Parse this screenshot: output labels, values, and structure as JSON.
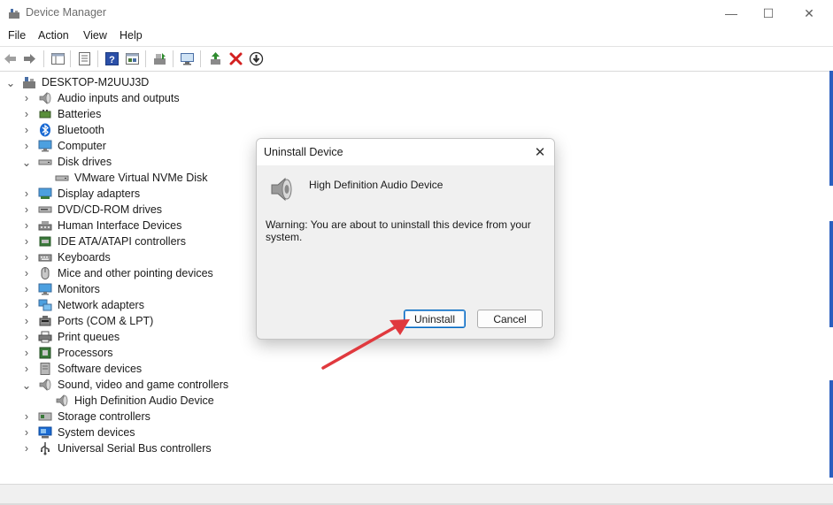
{
  "window": {
    "title": "Device Manager",
    "minimize_glyph": "—",
    "maximize_glyph": "☐",
    "close_glyph": "✕"
  },
  "menu": [
    "File",
    "Action",
    "View",
    "Help"
  ],
  "toolbar_icons": [
    "back-icon",
    "forward-icon",
    "properties-pane-icon",
    "properties-icon",
    "help-icon",
    "console-view-icon",
    "update-driver-icon",
    "scan-hardware-icon",
    "enable-device-icon",
    "uninstall-device-icon",
    "download-driver-icon"
  ],
  "tree": {
    "root": "DESKTOP-M2UUJ3D",
    "items": [
      {
        "label": "Audio inputs and outputs",
        "expander": "›",
        "icon": "speaker-icon"
      },
      {
        "label": "Batteries",
        "expander": "›",
        "icon": "battery-icon"
      },
      {
        "label": "Bluetooth",
        "expander": "›",
        "icon": "bluetooth-icon"
      },
      {
        "label": "Computer",
        "expander": "›",
        "icon": "computer-icon"
      },
      {
        "label": "Disk drives",
        "expander": "⌄",
        "icon": "disk-drive-icon"
      },
      {
        "label": "VMware Virtual NVMe Disk",
        "child": true,
        "icon": "disk-drive-icon"
      },
      {
        "label": "Display adapters",
        "expander": "›",
        "icon": "display-adapter-icon"
      },
      {
        "label": "DVD/CD-ROM drives",
        "expander": "›",
        "icon": "dvd-drive-icon"
      },
      {
        "label": "Human Interface Devices",
        "expander": "›",
        "icon": "hid-icon"
      },
      {
        "label": "IDE ATA/ATAPI controllers",
        "expander": "›",
        "icon": "ide-controller-icon"
      },
      {
        "label": "Keyboards",
        "expander": "›",
        "icon": "keyboard-icon"
      },
      {
        "label": "Mice and other pointing devices",
        "expander": "›",
        "icon": "mouse-icon"
      },
      {
        "label": "Monitors",
        "expander": "›",
        "icon": "monitor-icon"
      },
      {
        "label": "Network adapters",
        "expander": "›",
        "icon": "network-adapter-icon"
      },
      {
        "label": "Ports (COM & LPT)",
        "expander": "›",
        "icon": "port-icon"
      },
      {
        "label": "Print queues",
        "expander": "›",
        "icon": "printer-icon"
      },
      {
        "label": "Processors",
        "expander": "›",
        "icon": "processor-icon"
      },
      {
        "label": "Software devices",
        "expander": "›",
        "icon": "software-device-icon"
      },
      {
        "label": "Sound, video and game controllers",
        "expander": "⌄",
        "icon": "speaker-icon"
      },
      {
        "label": "High Definition Audio Device",
        "child": true,
        "icon": "speaker-icon"
      },
      {
        "label": "Storage controllers",
        "expander": "›",
        "icon": "storage-controller-icon"
      },
      {
        "label": "System devices",
        "expander": "›",
        "icon": "system-device-icon"
      },
      {
        "label": "Universal Serial Bus controllers",
        "expander": "›",
        "icon": "usb-icon"
      }
    ]
  },
  "dialog": {
    "title": "Uninstall Device",
    "close_glyph": "✕",
    "device_name": "High Definition Audio Device",
    "warning": "Warning: You are about to uninstall this device from your system.",
    "uninstall_label": "Uninstall",
    "cancel_label": "Cancel"
  },
  "colors": {
    "annotation_arrow": "#e0393e",
    "accent": "#0067c0",
    "uninstall_red": "#d32020",
    "enable_green": "#2e8b2e"
  }
}
